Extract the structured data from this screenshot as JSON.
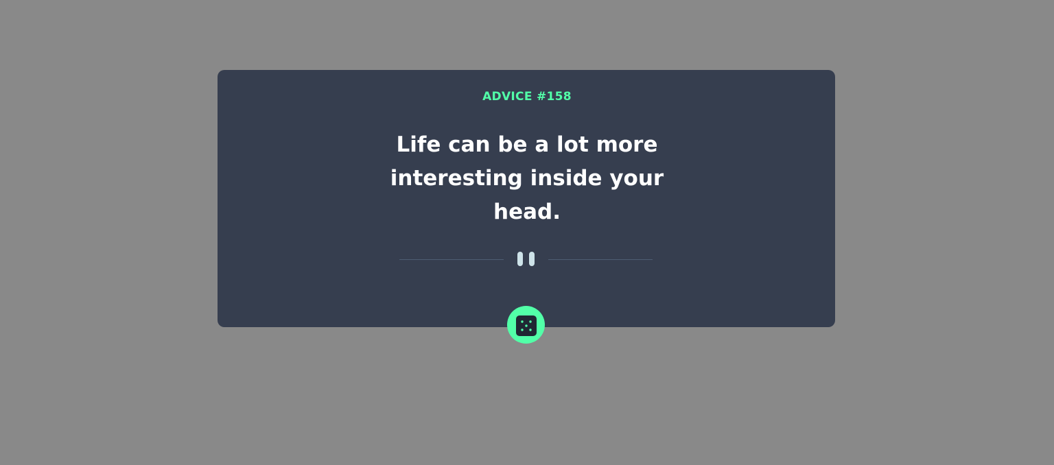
{
  "advice": {
    "id_label": "ADVICE #158",
    "quote": "Life can be a lot more interesting inside your head."
  },
  "divider": {
    "icon": "pause-icon",
    "line_color": "#4e5d73",
    "icon_color": "#cee3e9"
  },
  "button": {
    "icon": "dice-icon",
    "color": "#52ffa8"
  },
  "colors": {
    "page_background": "#898989",
    "card_background": "#363e4f",
    "accent": "#52ffa8",
    "text": "#ffffff"
  }
}
